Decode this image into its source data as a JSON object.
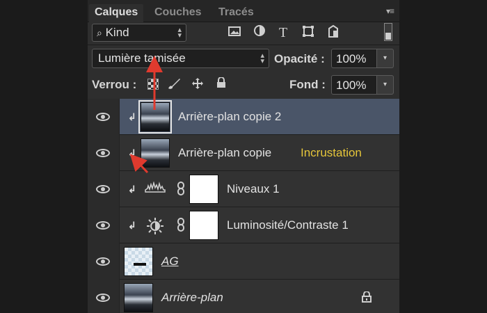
{
  "tabs": [
    {
      "label": "Calques",
      "active": true
    },
    {
      "label": "Couches",
      "active": false
    },
    {
      "label": "Tracés",
      "active": false
    }
  ],
  "filter": {
    "label": "Kind",
    "icons": [
      "image-filter-icon",
      "adjustment-filter-icon",
      "type-filter-icon",
      "shape-filter-icon",
      "smart-object-filter-icon"
    ]
  },
  "blend": {
    "mode": "Lumière tamisée",
    "opacity_label": "Opacité :",
    "opacity_value": "100%"
  },
  "lock": {
    "label": "Verrou :",
    "fill_label": "Fond :",
    "fill_value": "100%"
  },
  "layers": [
    {
      "name": "Arrière-plan copie 2",
      "selected": true,
      "clipped": true,
      "type": "image"
    },
    {
      "name": "Arrière-plan copie",
      "selected": false,
      "clipped": true,
      "type": "image"
    },
    {
      "name": "Niveaux 1",
      "selected": false,
      "clipped": true,
      "type": "levels"
    },
    {
      "name": "Luminosité/Contraste 1",
      "selected": false,
      "clipped": true,
      "type": "brightness-contrast"
    },
    {
      "name": "AG",
      "selected": false,
      "clipped": false,
      "type": "transparent"
    },
    {
      "name": "Arrière-plan",
      "selected": false,
      "clipped": false,
      "type": "background",
      "locked": true
    }
  ],
  "annotation": {
    "text": "Incrustation",
    "color": "#e6c63a",
    "arrow_color": "#e03a2e"
  },
  "icon_glyphs": {
    "clip": "↲",
    "chain": "⛓",
    "lock": "🔒",
    "brightness": "☼",
    "levels": "⩩",
    "brush": "✎",
    "move": "✥"
  }
}
